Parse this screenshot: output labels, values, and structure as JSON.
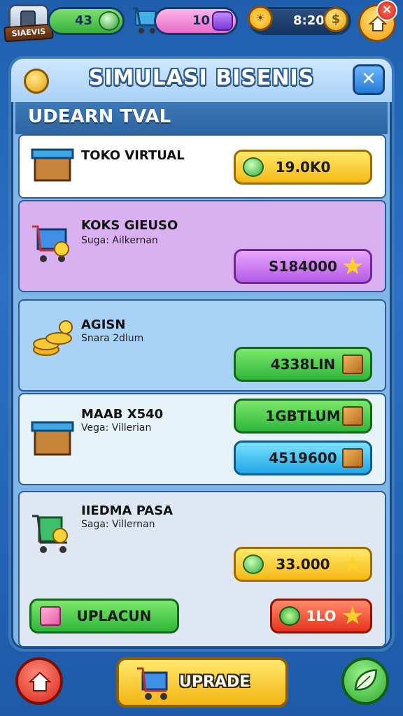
{
  "hud": {
    "logo_tag": "SIAEVIS",
    "green_value": "43",
    "pink_value": "10",
    "time": "8:20",
    "close_glyph": "×"
  },
  "panel": {
    "title": "SIMULASI BISENIS",
    "close_glyph": "✕",
    "section_title": "UDEARN TVAL"
  },
  "cards": [
    {
      "name": "TOKO VIRTUAL",
      "sub": "",
      "buttons": [
        {
          "label": "19.0K0",
          "icon": "coin-icon"
        }
      ]
    },
    {
      "name": "KOKS GIEUSO",
      "sub": "Suga: Ailkernan",
      "buttons": [
        {
          "label": "S184000",
          "icon": "star-icon"
        }
      ]
    },
    {
      "name": "AGISN",
      "sub": "Snara 2dlum",
      "buttons": [
        {
          "label": "4338LIN",
          "icon": "crate-icon"
        }
      ]
    },
    {
      "name": "MAAB X540",
      "sub": "Vega: Villerian",
      "buttons": [
        {
          "label": "1GBTLUM",
          "icon": "crate-icon"
        },
        {
          "label": "4519600",
          "icon": "crate-icon"
        }
      ]
    },
    {
      "name": "IIEDMA PASA",
      "sub": "Saga: Villernan",
      "buttons": [
        {
          "label": "33.000",
          "icon": "coin-icon"
        }
      ]
    }
  ],
  "actions": {
    "uplacun": "UPLACUN",
    "red_value": "1LO"
  },
  "bottom": {
    "upgrade": "UPRADE"
  },
  "colors": {
    "background": "#2a71c4",
    "panel": "#7fb6e6",
    "accent_yellow": "#f4b916",
    "accent_green": "#2fb63a",
    "accent_purple": "#b65ae8"
  }
}
